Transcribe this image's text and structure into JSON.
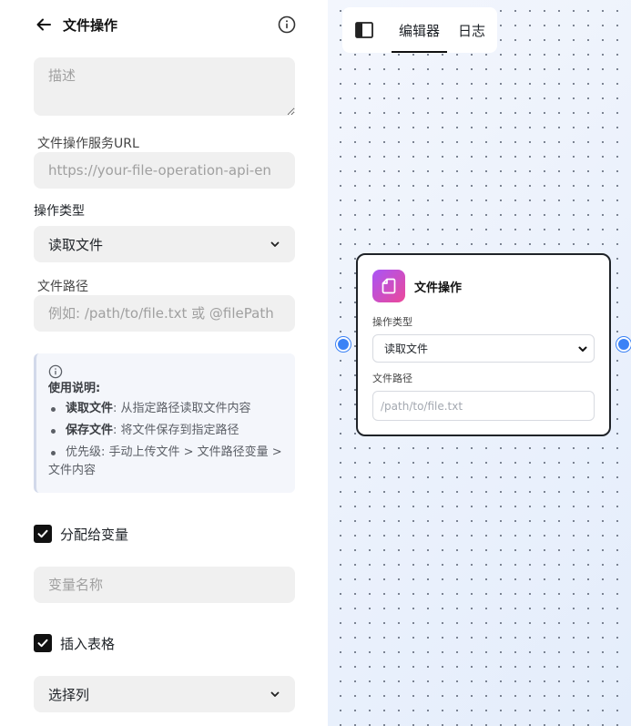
{
  "header": {
    "title": "文件操作"
  },
  "form": {
    "description_placeholder": "描述",
    "service_url_label": "文件操作服务URL",
    "service_url_placeholder": "https://your-file-operation-api-en",
    "operation_type_label": "操作类型",
    "operation_type_value": "读取文件",
    "file_path_label": "文件路径",
    "file_path_placeholder": "例如: /path/to/file.txt 或 @filePath",
    "usage_note": {
      "heading": "使用说明:",
      "items": [
        {
          "strong": "读取文件",
          "text": ": 从指定路径读取文件内容"
        },
        {
          "strong": "保存文件",
          "text": ": 将文件保存到指定路径"
        },
        {
          "strong": "",
          "text": "优先级: 手动上传文件 > 文件路径变量 > 文件内容"
        }
      ]
    },
    "assign_variable": {
      "label": "分配给变量",
      "checked": true
    },
    "variable_name_placeholder": "变量名称",
    "insert_table": {
      "label": "插入表格",
      "checked": true
    },
    "select_column_value": "选择列"
  },
  "canvas": {
    "tabs": [
      {
        "label": "编辑器",
        "active": true
      },
      {
        "label": "日志",
        "active": false
      }
    ],
    "node": {
      "title": "文件操作",
      "operation_type_label": "操作类型",
      "operation_type_value": "读取文件",
      "file_path_label": "文件路径",
      "file_path_placeholder": "/path/to/file.txt"
    }
  },
  "colors": {
    "accent": "#3b82f6",
    "node_icon_start": "#a855f7",
    "node_icon_end": "#ec4899",
    "checkbox": "#111111"
  },
  "icons": [
    "back-arrow-icon",
    "info-icon",
    "chevron-down-icon",
    "check-icon",
    "sidebar-toggle-icon",
    "file-icon"
  ]
}
